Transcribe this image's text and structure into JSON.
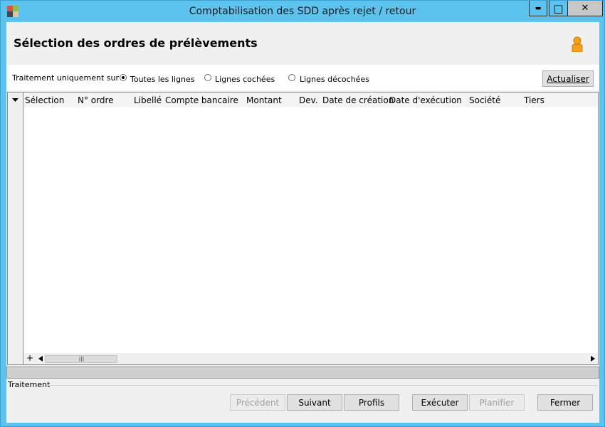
{
  "window": {
    "title": "Comptabilisation des SDD après rejet / retour",
    "minimize_glyph": "▬",
    "maximize_glyph": "□",
    "close_glyph": "✕"
  },
  "header": {
    "title": "Sélection des ordres de prélèvements",
    "user_icon": "user-icon"
  },
  "filter": {
    "label": "Traitement uniquement sur :",
    "options": [
      {
        "label": "Toutes les lignes",
        "checked": true
      },
      {
        "label": "Lignes cochées",
        "checked": false
      },
      {
        "label": "Lignes décochées",
        "checked": false
      }
    ],
    "refresh_button": "Actualiser"
  },
  "grid": {
    "columns": [
      "Sélection",
      "N° ordre",
      "Libellé",
      "Compte bancaire",
      "Montant",
      "Dev.",
      "Date de création",
      "Date d'exécution",
      "Société",
      "Tiers"
    ],
    "rows": []
  },
  "footer": {
    "section_label": "Traitement",
    "buttons": {
      "previous": "Précédent",
      "next": "Suivant",
      "profiles": "Profils",
      "execute": "Exécuter",
      "schedule": "Planifier",
      "close": "Fermer"
    }
  },
  "colors": {
    "titlebar": "#5bc3ee",
    "window_bg": "#f0f0f0",
    "icon_user": "#f4a21d"
  }
}
